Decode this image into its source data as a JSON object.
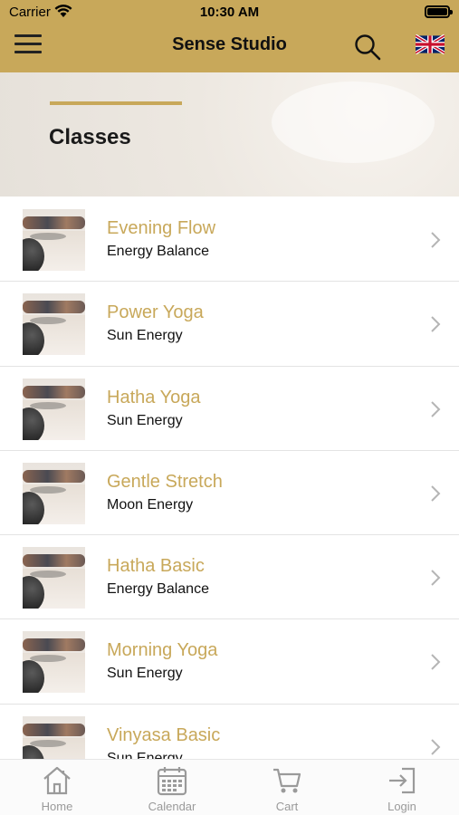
{
  "status_bar": {
    "carrier": "Carrier",
    "time": "10:30 AM"
  },
  "nav": {
    "title": "Sense Studio",
    "menu_icon": "hamburger-icon",
    "search_icon": "search-icon",
    "language_icon": "uk-flag-icon"
  },
  "hero": {
    "heading": "Classes"
  },
  "classes": [
    {
      "title": "Evening Flow",
      "subtitle": "Energy Balance"
    },
    {
      "title": "Power Yoga",
      "subtitle": "Sun Energy"
    },
    {
      "title": "Hatha Yoga",
      "subtitle": "Sun Energy"
    },
    {
      "title": "Gentle Stretch",
      "subtitle": "Moon Energy"
    },
    {
      "title": "Hatha Basic",
      "subtitle": "Energy Balance"
    },
    {
      "title": "Morning Yoga",
      "subtitle": "Sun Energy"
    },
    {
      "title": "Vinyasa Basic",
      "subtitle": "Sun Energy"
    }
  ],
  "tabbar": {
    "tabs": [
      {
        "label": "Home",
        "icon": "home-icon"
      },
      {
        "label": "Calendar",
        "icon": "calendar-icon"
      },
      {
        "label": "Cart",
        "icon": "cart-icon"
      },
      {
        "label": "Login",
        "icon": "login-icon"
      }
    ]
  },
  "colors": {
    "accent": "#c8a85a",
    "tab_inactive": "#9a9a9a"
  }
}
